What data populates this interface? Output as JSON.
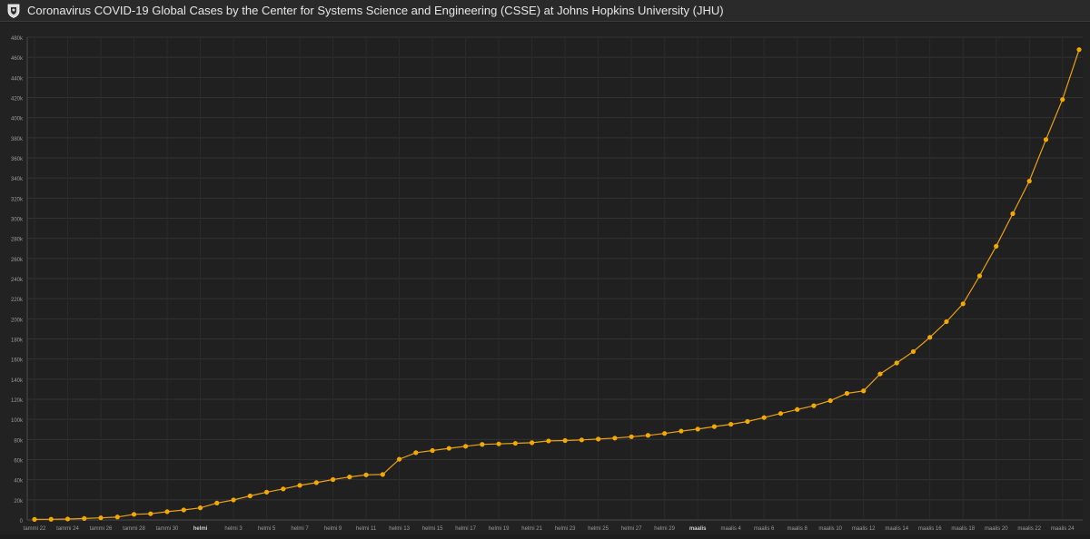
{
  "header": {
    "title": "Coronavirus COVID-19 Global Cases by the Center for Systems Science and Engineering (CSSE) at Johns Hopkins University (JHU)",
    "logo_icon": "jhu-shield-icon"
  },
  "colors": {
    "background": "#222222",
    "line": "#e8a317",
    "point": "#f5a800",
    "grid": "#333333",
    "tick_text": "#9a9a9a"
  },
  "chart_data": {
    "type": "line",
    "title": "",
    "xlabel": "",
    "ylabel": "",
    "ylim": [
      0,
      480000
    ],
    "y_ticks": [
      0,
      20000,
      40000,
      60000,
      80000,
      100000,
      120000,
      140000,
      160000,
      180000,
      200000,
      220000,
      240000,
      260000,
      280000,
      300000,
      320000,
      340000,
      360000,
      380000,
      400000,
      420000,
      440000,
      460000,
      480000
    ],
    "y_tick_labels": [
      "0",
      "20k",
      "40k",
      "60k",
      "80k",
      "100k",
      "120k",
      "140k",
      "160k",
      "180k",
      "200k",
      "220k",
      "240k",
      "260k",
      "280k",
      "300k",
      "320k",
      "340k",
      "360k",
      "380k",
      "400k",
      "420k",
      "440k",
      "460k",
      "480k"
    ],
    "x_tick_labels": [
      {
        "day": 0,
        "label": "tammi 22",
        "bold": false
      },
      {
        "day": 2,
        "label": "tammi 24",
        "bold": false
      },
      {
        "day": 4,
        "label": "tammi 26",
        "bold": false
      },
      {
        "day": 6,
        "label": "tammi 28",
        "bold": false
      },
      {
        "day": 8,
        "label": "tammi 30",
        "bold": false
      },
      {
        "day": 10,
        "label": "helmi",
        "bold": true
      },
      {
        "day": 12,
        "label": "helmi 3",
        "bold": false
      },
      {
        "day": 14,
        "label": "helmi 5",
        "bold": false
      },
      {
        "day": 16,
        "label": "helmi 7",
        "bold": false
      },
      {
        "day": 18,
        "label": "helmi 9",
        "bold": false
      },
      {
        "day": 20,
        "label": "helmi 11",
        "bold": false
      },
      {
        "day": 22,
        "label": "helmi 13",
        "bold": false
      },
      {
        "day": 24,
        "label": "helmi 15",
        "bold": false
      },
      {
        "day": 26,
        "label": "helmi 17",
        "bold": false
      },
      {
        "day": 28,
        "label": "helmi 19",
        "bold": false
      },
      {
        "day": 30,
        "label": "helmi 21",
        "bold": false
      },
      {
        "day": 32,
        "label": "helmi 23",
        "bold": false
      },
      {
        "day": 34,
        "label": "helmi 25",
        "bold": false
      },
      {
        "day": 36,
        "label": "helmi 27",
        "bold": false
      },
      {
        "day": 38,
        "label": "helmi 29",
        "bold": false
      },
      {
        "day": 40,
        "label": "maalis",
        "bold": true
      },
      {
        "day": 42,
        "label": "maalis 4",
        "bold": false
      },
      {
        "day": 44,
        "label": "maalis 6",
        "bold": false
      },
      {
        "day": 46,
        "label": "maalis 8",
        "bold": false
      },
      {
        "day": 48,
        "label": "maalis 10",
        "bold": false
      },
      {
        "day": 50,
        "label": "maalis 12",
        "bold": false
      },
      {
        "day": 52,
        "label": "maalis 14",
        "bold": false
      },
      {
        "day": 54,
        "label": "maalis 16",
        "bold": false
      },
      {
        "day": 56,
        "label": "maalis 18",
        "bold": false
      },
      {
        "day": 58,
        "label": "maalis 20",
        "bold": false
      },
      {
        "day": 60,
        "label": "maalis 22",
        "bold": false
      },
      {
        "day": 62,
        "label": "maalis 24",
        "bold": false
      }
    ],
    "series": [
      {
        "x": [
          0,
          1,
          2,
          3,
          4,
          5,
          6,
          7,
          8,
          9,
          10,
          11,
          12,
          13,
          14,
          15,
          16,
          17,
          18,
          19,
          20,
          21,
          22,
          23,
          24,
          25,
          26,
          27,
          28,
          29,
          30,
          31,
          32,
          33,
          34,
          35,
          36,
          37,
          38,
          39,
          40,
          41,
          42,
          43,
          44,
          45,
          46,
          47,
          48,
          49,
          50,
          51,
          52,
          53,
          54,
          55,
          56,
          57,
          58,
          59,
          60,
          61,
          62,
          63
        ],
        "values": [
          555,
          654,
          941,
          1434,
          2118,
          2927,
          5578,
          6166,
          8234,
          9927,
          12038,
          16787,
          19881,
          23892,
          27635,
          30817,
          34391,
          37120,
          40150,
          42762,
          44802,
          45221,
          60368,
          66885,
          69030,
          71224,
          73258,
          75136,
          75639,
          76197,
          76819,
          78572,
          78958,
          79561,
          80406,
          81388,
          82746,
          84112,
          86011,
          88369,
          90306,
          92840,
          95120,
          97886,
          101801,
          105847,
          109821,
          113590,
          118620,
          125875,
          128343,
          145193,
          156099,
          167447,
          181546,
          197168,
          214915,
          242713,
          272167,
          304528,
          336953,
          378235,
          418045,
          467653
        ]
      }
    ]
  }
}
